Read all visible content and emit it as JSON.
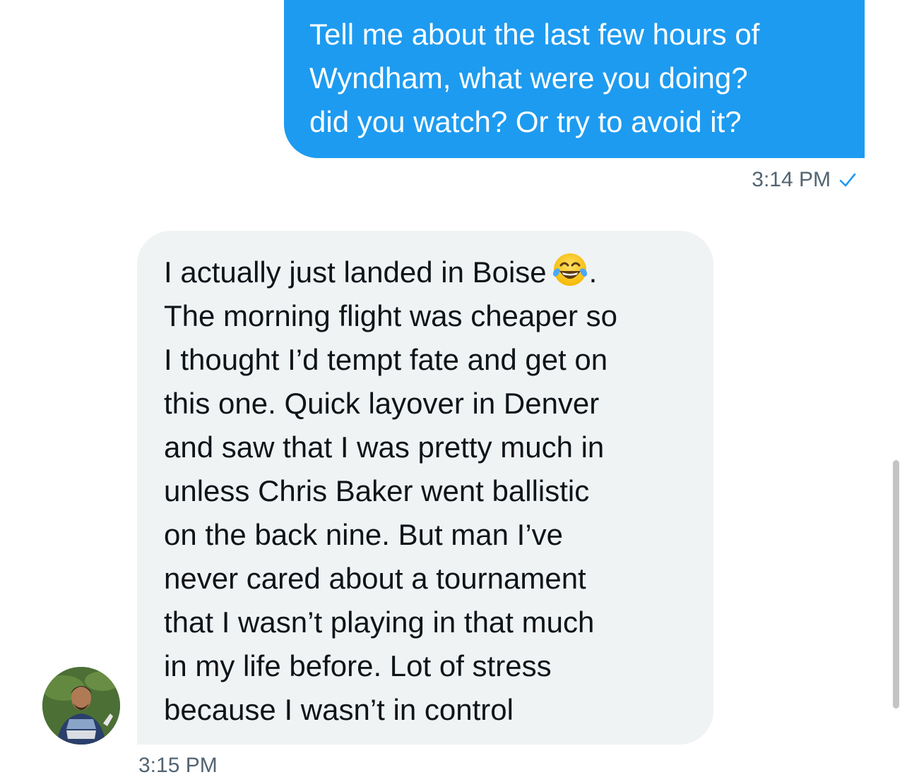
{
  "conversation": {
    "sent_message": {
      "lines": "Tell me about the last few hours of\nWyndham, what were you doing?\ndid you watch? Or try to avoid it?",
      "time": "3:14 PM",
      "status_icon": "check-icon"
    },
    "received_message": {
      "line_1": "I actually just landed in Boise",
      "emoji": "tears-of-joy-emoji",
      "line_1_end": ".",
      "rest": "The morning flight was cheaper so\nI thought I’d tempt fate and get on\nthis one. Quick layover in Denver\nand saw that I was pretty much in\nunless Chris Baker went ballistic\non the back nine. But man I’ve\nnever cared about a tournament\nthat I wasn’t playing in that much\nin my life before. Lot of stress\nbecause I wasn’t in control",
      "time": "3:15 PM"
    }
  },
  "colors": {
    "sent_bubble": "#1d9bf0",
    "received_bubble": "#eff3f4",
    "meta_text": "#536471"
  }
}
